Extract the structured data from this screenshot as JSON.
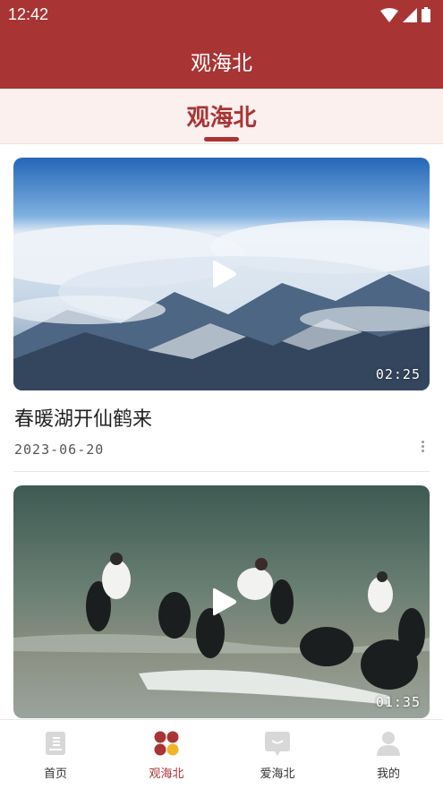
{
  "status_bar": {
    "time": "12:42"
  },
  "header": {
    "title": "观海北"
  },
  "subheader": {
    "title": "观海北"
  },
  "videos": [
    {
      "title": "春暖湖开仙鹤来",
      "date": "2023-06-20",
      "duration": "02:25"
    },
    {
      "duration": "01:35"
    }
  ],
  "tabbar": {
    "items": [
      {
        "label": "首页",
        "icon": "home-icon"
      },
      {
        "label": "观海北",
        "icon": "dots-icon"
      },
      {
        "label": "爱海北",
        "icon": "message-icon"
      },
      {
        "label": "我的",
        "icon": "person-icon"
      }
    ],
    "active": 1
  },
  "colors": {
    "brand": "#a93434",
    "subheader_bg": "#fbf0ee"
  }
}
